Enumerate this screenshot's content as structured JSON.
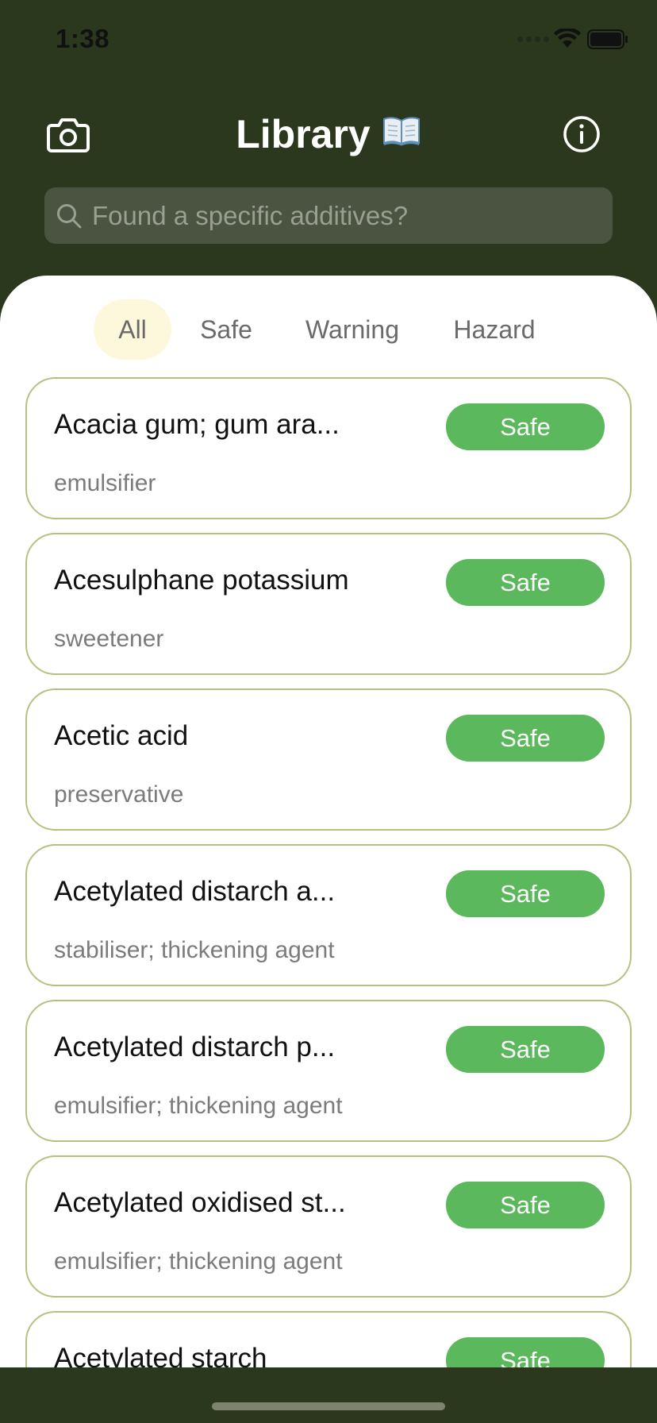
{
  "status_bar": {
    "time": "1:38"
  },
  "header": {
    "title": "Library",
    "title_emoji": "📖",
    "camera_icon": "camera-icon",
    "info_icon": "info-icon"
  },
  "search": {
    "placeholder": "Found a specific additives?",
    "icon": "search-icon"
  },
  "tabs": [
    {
      "label": "All",
      "selected": true
    },
    {
      "label": "Safe",
      "selected": false
    },
    {
      "label": "Warning",
      "selected": false
    },
    {
      "label": "Hazard",
      "selected": false
    }
  ],
  "items": [
    {
      "name": "Acacia gum; gum ara...",
      "type": "emulsifier",
      "status": "Safe"
    },
    {
      "name": "Acesulphane potassium",
      "type": "sweetener",
      "status": "Safe"
    },
    {
      "name": "Acetic acid",
      "type": "preservative",
      "status": "Safe"
    },
    {
      "name": "Acetylated distarch a...",
      "type": "stabiliser; thickening agent",
      "status": "Safe"
    },
    {
      "name": "Acetylated distarch p...",
      "type": "emulsifier; thickening agent",
      "status": "Safe"
    },
    {
      "name": "Acetylated oxidised st...",
      "type": "emulsifier; thickening agent",
      "status": "Safe"
    },
    {
      "name": "Acetylated starch",
      "type": "",
      "status": "Safe"
    }
  ],
  "colors": {
    "header_bg": "#2c381d",
    "safe_badge": "#5cb85c",
    "card_border": "#b7c083",
    "selected_tab_bg": "#fdf7dc"
  }
}
